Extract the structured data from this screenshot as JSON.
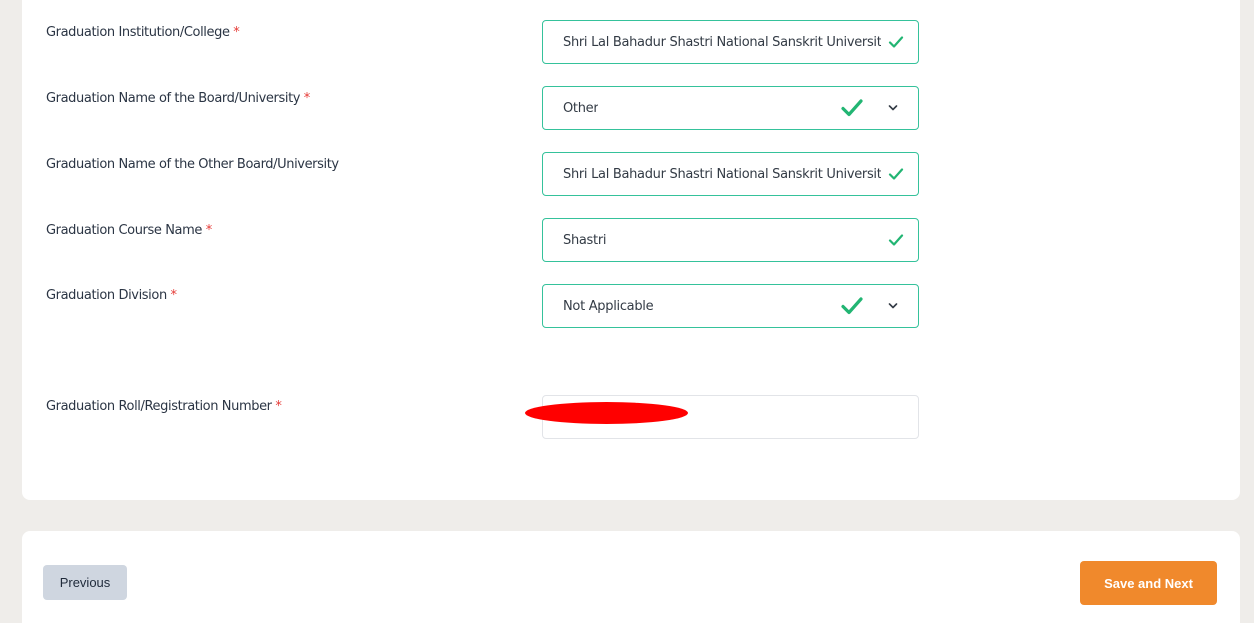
{
  "form": {
    "fields": [
      {
        "label": "Graduation Institution/College",
        "required": "*",
        "value": "Shri Lal Bahadur Shastri National Sanskrit University"
      },
      {
        "label": "Graduation Name of the Board/University",
        "required": "*",
        "value": "Other"
      },
      {
        "label": "Graduation Name of the Other Board/University",
        "required": "",
        "value": "Shri Lal Bahadur Shastri National Sanskrit University"
      },
      {
        "label": "Graduation Course Name",
        "required": "*",
        "value": "Shastri"
      },
      {
        "label": "Graduation Division",
        "required": "*",
        "value": "Not Applicable"
      },
      {
        "label": "Graduation Roll/Registration Number",
        "required": "*",
        "value": ""
      }
    ]
  },
  "footer": {
    "previous_label": "Previous",
    "save_next_label": "Save and Next"
  },
  "colors": {
    "valid_border": "#35c29b",
    "check": "#22b573",
    "primary": "#f0892c",
    "secondary": "#cfd6e0",
    "required": "#e53935"
  },
  "icons": [
    "check-icon",
    "chevron-down-icon"
  ]
}
